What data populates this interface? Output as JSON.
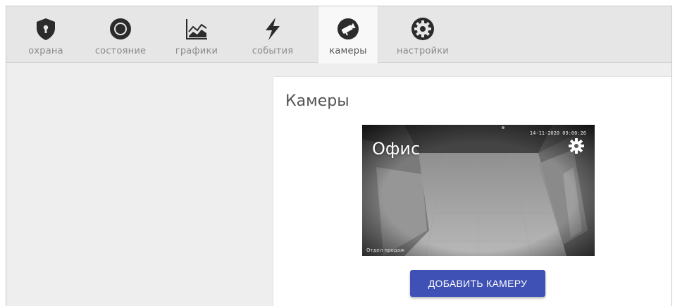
{
  "tabs": [
    {
      "label": "охрана",
      "icon": "shield-icon"
    },
    {
      "label": "состояние",
      "icon": "ring-icon"
    },
    {
      "label": "графики",
      "icon": "chart-icon"
    },
    {
      "label": "события",
      "icon": "lightning-icon"
    },
    {
      "label": "камеры",
      "icon": "camera-icon",
      "active": true
    },
    {
      "label": "настройки",
      "icon": "gear-icon"
    }
  ],
  "main": {
    "title": "Камеры",
    "cameras": [
      {
        "name": "Офис",
        "timestamp": "14-11-2020 09:00:26",
        "overlay_label": "Отдел продаж"
      }
    ],
    "add_button_label": "ДОБАВИТЬ КАМЕРУ"
  },
  "colors": {
    "accent": "#3f51b5",
    "icon": "#2b2b2b",
    "tab_label": "#8c8c8c",
    "background": "#eeeeee"
  }
}
